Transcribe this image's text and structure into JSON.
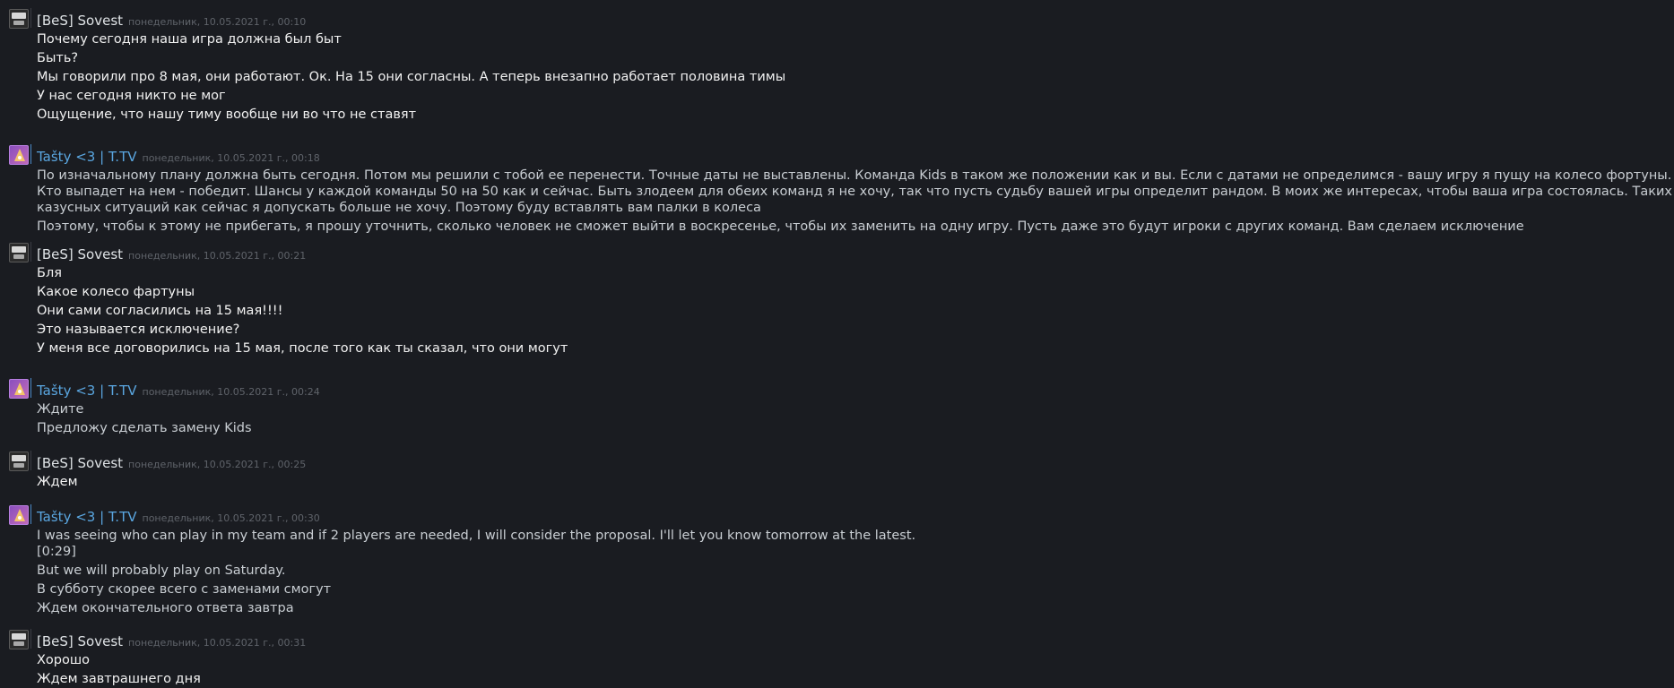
{
  "chat": {
    "groups": [
      {
        "author": "[BeS] Sovest",
        "time": "понедельник, 10.05.2021 г., 00:10",
        "messages": [
          "Почему сегодня наша игра должна был быт",
          "Быть?",
          "Мы говорили про 8 мая, они работают. Ок. На 15 они согласны. А теперь внезапно работает половина тимы",
          "У нас сегодня никто не мог",
          "Ощущение, что нашу тиму вообще ни во что не ставят"
        ]
      },
      {
        "author": "Tašty <3 | T.TV",
        "time": "понедельник, 10.05.2021 г., 00:18",
        "messages": [
          "По изначальному плану должна быть сегодня. Потом мы решили с тобой ее перенести. Точные даты не выставлены. Команда Kids в таком же положении как и вы. Если с датами не определимся - вашу игру я пущу на колесо фортуны. Кто выпадет на нем - победит. Шансы у каждой команды 50 на 50 как и сейчас. Быть злодеем для обеих команд я не хочу, так что пусть судьбу вашей игры определит рандом. В моих же интересах, чтобы ваша игра состоялась. Таких казусных ситуаций как сейчас я допускать больше не хочу. Поэтому буду вставлять вам палки в колеса",
          "Поэтому, чтобы к этому не прибегать, я прошу уточнить, сколько человек не сможет выйти в воскресенье, чтобы их заменить на одну игру. Пусть даже это будут игроки с других команд. Вам сделаем исключение"
        ]
      },
      {
        "author": "[BeS] Sovest",
        "time": "понедельник, 10.05.2021 г., 00:21",
        "messages": [
          "Бля",
          "Какое колесо фартуны",
          "Они сами согласились на 15 мая!!!!",
          "Это называется исключение?",
          "У меня все договорились на 15 мая, после того как ты сказал, что они могут"
        ]
      },
      {
        "author": "Tašty <3 | T.TV",
        "time": "понедельник, 10.05.2021 г., 00:24",
        "messages": [
          "Ждите",
          "Предложу сделать замену Kids"
        ]
      },
      {
        "author": "[BeS] Sovest",
        "time": "понедельник, 10.05.2021 г., 00:25",
        "messages": [
          "Ждем"
        ]
      },
      {
        "author": "Tašty <3 | T.TV",
        "time": "понедельник, 10.05.2021 г., 00:30",
        "messages": [
          "I was seeing who can play in my team and if 2 players are needed, I will consider the proposal. I'll let you know tomorrow at the latest.",
          "[0:29]",
          "But we will probably play on Saturday.",
          "В субботу скорее всего с заменами смогут",
          "Ждем окончательного ответа завтра"
        ]
      },
      {
        "author": "[BeS] Sovest",
        "time": "понедельник, 10.05.2021 г., 00:31",
        "messages": [
          "Хорошо",
          "Ждем завтрашнего дня"
        ]
      }
    ]
  }
}
